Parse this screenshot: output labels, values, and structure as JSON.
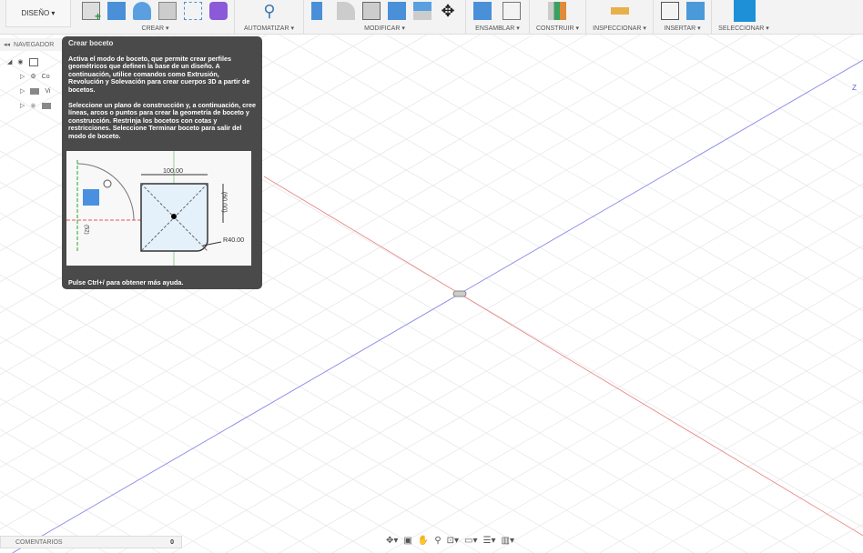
{
  "toolbar": {
    "design_label": "DISEÑO ▾",
    "groups": [
      {
        "label": "CREAR ▾"
      },
      {
        "label": "AUTOMATIZAR ▾"
      },
      {
        "label": "MODIFICAR ▾"
      },
      {
        "label": "ENSAMBLAR ▾"
      },
      {
        "label": "CONSTRUIR ▾"
      },
      {
        "label": "INSPECCIONAR ▾"
      },
      {
        "label": "INSERTAR ▾"
      },
      {
        "label": "SELECCIONAR ▾"
      }
    ]
  },
  "navigator": {
    "label": "NAVEGADOR",
    "items": [
      "Co",
      "Vi",
      ""
    ]
  },
  "tooltip": {
    "title": "Crear boceto",
    "para1": "Activa el modo de boceto, que permite crear perfiles geométricos que definen la base de un diseño. A continuación, utilice comandos como Extrusión, Revolución y Solevación para crear cuerpos 3D a partir de bocetos.",
    "para2": "Seleccione un plano de construcción y, a continuación, cree líneas, arcos o puntos para crear la geometría de boceto y construcción. Restrinja los bocetos con cotas y restricciones. Seleccione Terminar boceto para salir del modo de boceto.",
    "image": {
      "dim_width": "100.00",
      "dim_height": "(60.00)",
      "radius": "R40.00",
      "dim_left": "(52)"
    },
    "footer": "Pulse Ctrl+/ para obtener más ayuda."
  },
  "comments": {
    "label": "COMENTARIOS",
    "count": "0"
  },
  "axis_label": "Z",
  "colors": {
    "x_axis": "#e88a8a",
    "z_axis": "#8a8ae8",
    "tooltip_bg": "#4a4a4a",
    "accent": "#1e90d8"
  }
}
